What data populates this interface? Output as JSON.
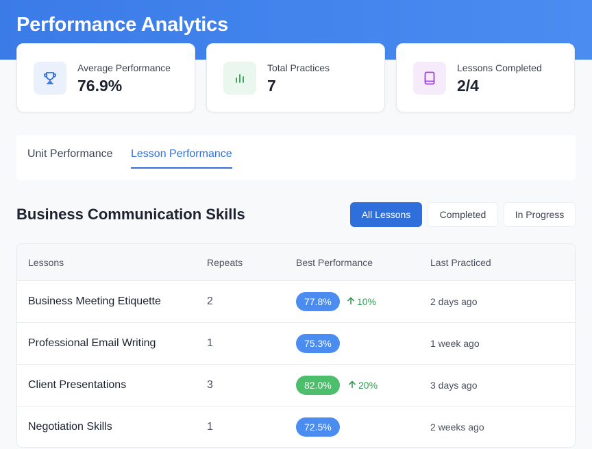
{
  "header": {
    "title": "Performance Analytics"
  },
  "stats": [
    {
      "label": "Average Performance",
      "value": "76.9%",
      "icon": "trophy-icon",
      "icon_color": "#2f6fdc",
      "icon_bg": "#eaf1fd"
    },
    {
      "label": "Total Practices",
      "value": "7",
      "icon": "bar-chart-icon",
      "icon_color": "#2f9d52",
      "icon_bg": "#eaf7ee"
    },
    {
      "label": "Lessons Completed",
      "value": "2/4",
      "icon": "book-icon",
      "icon_color": "#9b3fd6",
      "icon_bg": "#f5ebfb"
    }
  ],
  "tabs": [
    {
      "label": "Unit Performance",
      "active": false
    },
    {
      "label": "Lesson Performance",
      "active": true
    }
  ],
  "section": {
    "title": "Business Communication Skills",
    "filters": [
      {
        "label": "All Lessons",
        "active": true
      },
      {
        "label": "Completed",
        "active": false
      },
      {
        "label": "In Progress",
        "active": false
      }
    ]
  },
  "table": {
    "headers": [
      "Lessons",
      "Repeats",
      "Best Performance",
      "Last Practiced"
    ],
    "rows": [
      {
        "lesson": "Business Meeting Etiquette",
        "repeats": "2",
        "best": "77.8%",
        "trend": "10%",
        "pill_color": "#4a8cf0",
        "last": "2 days ago"
      },
      {
        "lesson": "Professional Email Writing",
        "repeats": "1",
        "best": "75.3%",
        "trend": "",
        "pill_color": "#4a8cf0",
        "last": "1 week ago"
      },
      {
        "lesson": "Client Presentations",
        "repeats": "3",
        "best": "82.0%",
        "trend": "20%",
        "pill_color": "#4cbe6c",
        "last": "3 days ago"
      },
      {
        "lesson": "Negotiation Skills",
        "repeats": "1",
        "best": "72.5%",
        "trend": "",
        "pill_color": "#4a8cf0",
        "last": "2 weeks ago"
      }
    ]
  },
  "colors": {
    "accent": "#2f6fdc",
    "positive": "#2f9d52"
  }
}
